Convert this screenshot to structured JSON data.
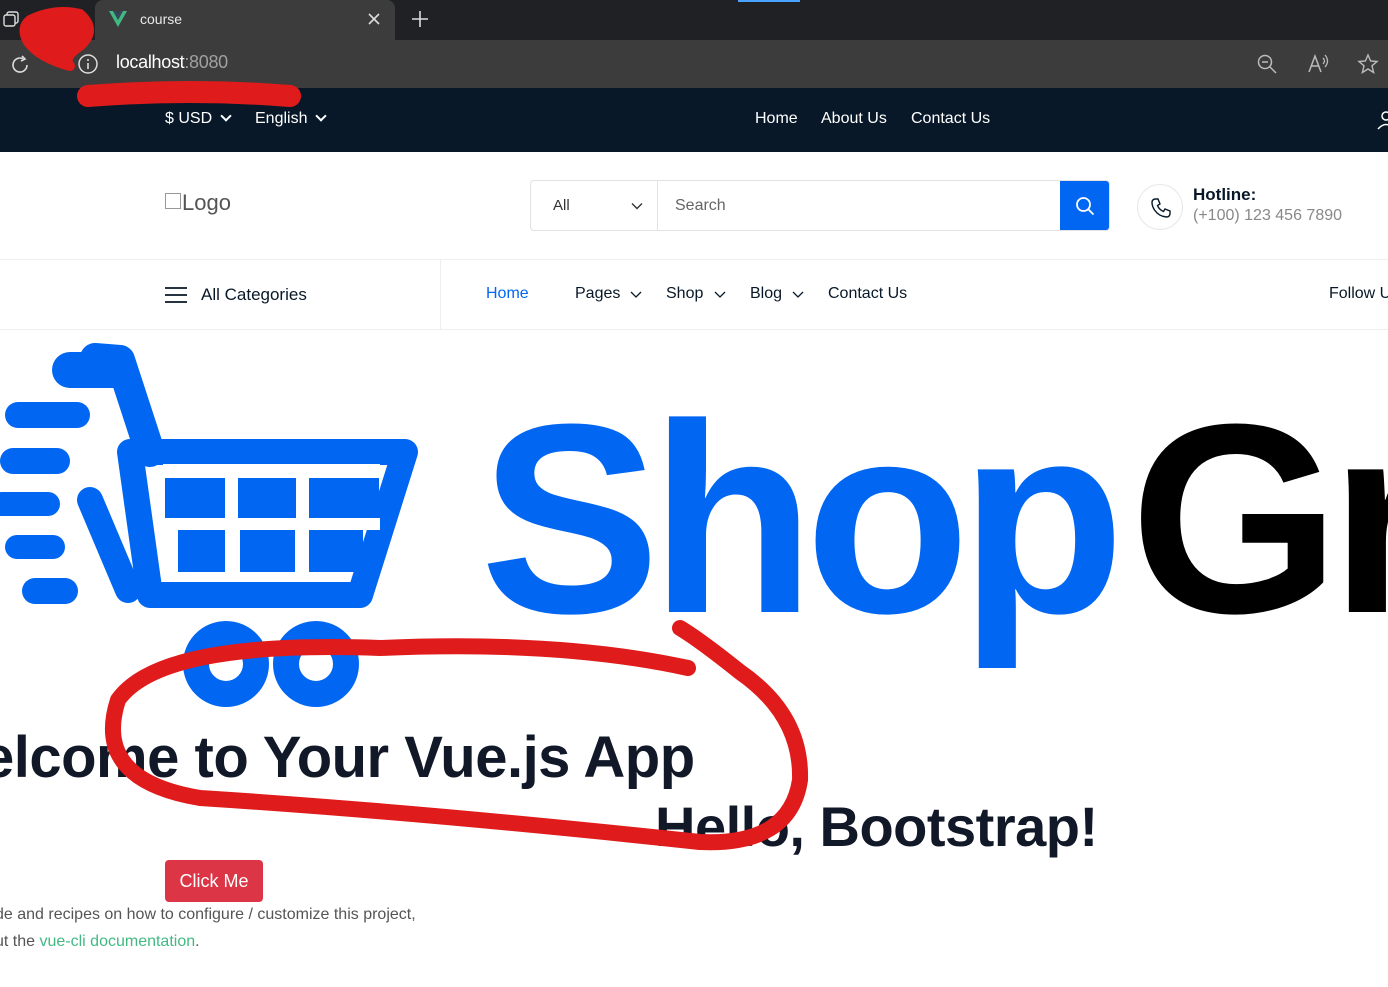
{
  "browser": {
    "tab_title": "course",
    "url_host": "localhost",
    "url_port": ":8080"
  },
  "topbar": {
    "currency": "$ USD",
    "language": "English",
    "links": [
      "Home",
      "About Us",
      "Contact Us"
    ]
  },
  "header": {
    "logo_alt": "Logo",
    "search_category": "All",
    "search_placeholder": "Search",
    "hotline_label": "Hotline:",
    "hotline_number": "(+100) 123 456 7890"
  },
  "nav": {
    "all_categories": "All Categories",
    "items": [
      {
        "label": "Home",
        "active": true,
        "dropdown": false
      },
      {
        "label": "Pages",
        "active": false,
        "dropdown": true
      },
      {
        "label": "Shop",
        "active": false,
        "dropdown": true
      },
      {
        "label": "Blog",
        "active": false,
        "dropdown": true
      },
      {
        "label": "Contact Us",
        "active": false,
        "dropdown": false
      }
    ],
    "follow": "Follow U"
  },
  "hero": {
    "brand_part1": "Shop",
    "brand_part2": "Gr",
    "welcome": "elcome to Your Vue.js App",
    "hello": "Hello, Bootstrap!",
    "button_label": "Click Me",
    "info_line1": "de and recipes on how to configure / customize this project,",
    "info_line2_prefix": "ut the ",
    "info_line2_link": "vue-cli documentation",
    "info_line2_suffix": "."
  },
  "colors": {
    "brand_blue": "#0167f3",
    "topbar_bg": "#081828",
    "danger": "#dc3545",
    "vue_green": "#42b983",
    "scribble_red": "#e01b1b"
  }
}
